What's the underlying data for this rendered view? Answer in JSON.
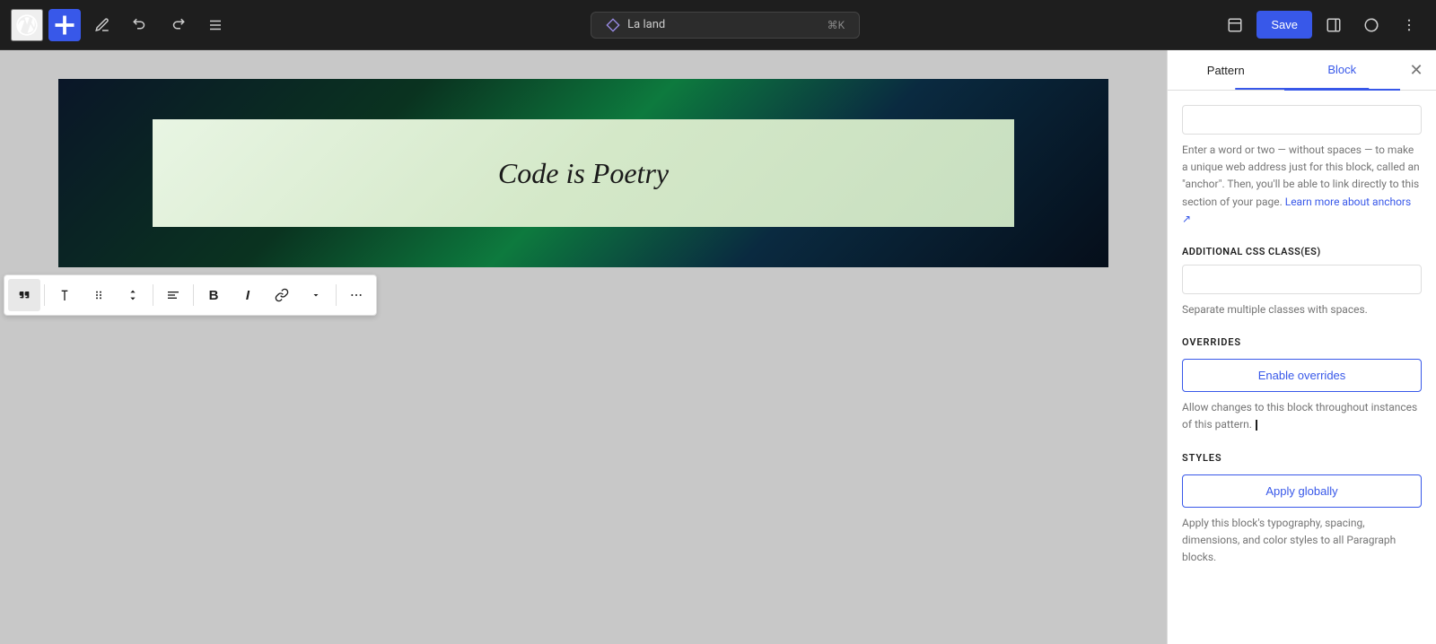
{
  "topbar": {
    "add_label": "+",
    "save_label": "Save",
    "command_bar": {
      "icon": "diamond-icon",
      "label": "La land",
      "shortcut": "⌘K"
    }
  },
  "canvas": {
    "banner_text": "Code is Poetry"
  },
  "toolbar": {
    "quote_btn": "❝",
    "paragraph_btn": "¶",
    "move_btn": "⠿",
    "up_down_btn": "↕",
    "align_btn": "≡",
    "bold_btn": "B",
    "italic_btn": "I",
    "link_btn": "🔗",
    "chevron_btn": "▾",
    "more_btn": "⋯"
  },
  "sidebar": {
    "tab_pattern_label": "Pattern",
    "tab_block_label": "Block",
    "anchor_input_placeholder": "",
    "anchor_description": "Enter a word or two — without spaces — to make a unique web address just for this block, called an \"anchor\". Then, you'll be able to link directly to this section of your page.",
    "anchor_link_text": "Learn more about anchors ↗",
    "anchor_link_href": "#",
    "css_class_section_label": "ADDITIONAL CSS CLASS(ES)",
    "css_class_input_placeholder": "",
    "css_class_description": "Separate multiple classes with spaces.",
    "overrides_section_label": "OVERRIDES",
    "enable_overrides_label": "Enable overrides",
    "overrides_description": "Allow changes to this block throughout instances of this pattern.",
    "styles_section_label": "STYLES",
    "apply_globally_label": "Apply globally",
    "styles_description": "Apply this block's typography, spacing, dimensions, and color styles to all Paragraph blocks."
  }
}
